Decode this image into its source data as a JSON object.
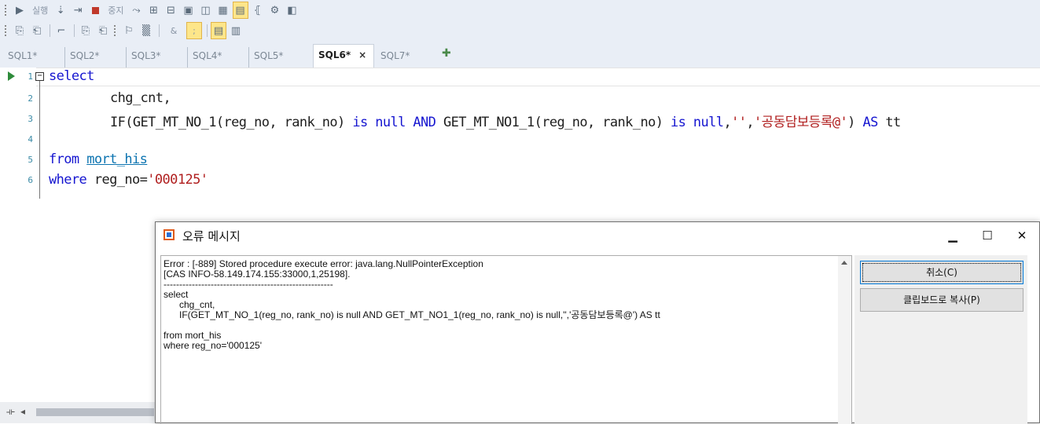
{
  "toolbar1": {
    "run_label": "실행",
    "stop_label": "중지"
  },
  "toolbar2": {
    "amp_label": "&",
    "semi_label": ";"
  },
  "tabs": [
    {
      "label": "SQL1*"
    },
    {
      "label": "SQL2*"
    },
    {
      "label": "SQL3*"
    },
    {
      "label": "SQL4*"
    },
    {
      "label": "SQL5*"
    },
    {
      "label": "SQL6*",
      "active": true
    },
    {
      "label": "SQL7*"
    }
  ],
  "tab_close": "×",
  "editor": {
    "lines": [
      {
        "num": "1"
      },
      {
        "num": "2"
      },
      {
        "num": "3"
      },
      {
        "num": "4"
      },
      {
        "num": "5"
      },
      {
        "num": "6"
      }
    ],
    "l1_kw": "select",
    "l2": "chg_cnt,",
    "l3_a": "IF(GET_MT_NO_1(reg_no, rank_no) ",
    "l3_kw1": "is null AND",
    "l3_b": " GET_MT_NO1_1(reg_no, rank_no) ",
    "l3_kw2": "is null",
    "l3_c": ",",
    "l3_str1": "''",
    "l3_d": ",",
    "l3_str2": "'공동담보등록@'",
    "l3_e": ") ",
    "l3_kw3": "AS",
    "l3_f": " tt",
    "l5_kw": "from",
    "l5_tbl": "mort_his",
    "l6_kw": "where",
    "l6_a": " reg_no=",
    "l6_str": "'000125'"
  },
  "dialog": {
    "title": "오류 메시지",
    "minimize": "▁",
    "maximize": "☐",
    "close": "✕",
    "message_lines": [
      "Error : [-889] Stored procedure execute error: java.lang.NullPointerException",
      "[CAS INFO-58.149.174.155:33000,1,25198].",
      "------------------------------------------------------",
      "select",
      "      chg_cnt,",
      "      IF(GET_MT_NO_1(reg_no, rank_no) is null AND GET_MT_NO1_1(reg_no, rank_no) is null,'','공동담보등록@') AS tt",
      "",
      "from mort_his",
      "where reg_no='000125'"
    ],
    "cancel_label": "취소(C)",
    "copy_label": "클립보드로 복사(P)"
  },
  "colors": {
    "keyword": "#1515d0",
    "string": "#b01e1e",
    "line_number": "#3a8aa6",
    "toolbar_bg": "#e9eef6",
    "run_arrow": "#2e8b3a",
    "stop": "#c0392b"
  },
  "icons": [
    "run-icon",
    "stop-icon",
    "new-tab-icon",
    "fold-icon",
    "dialog-app-icon",
    "scroll-up-icon"
  ]
}
